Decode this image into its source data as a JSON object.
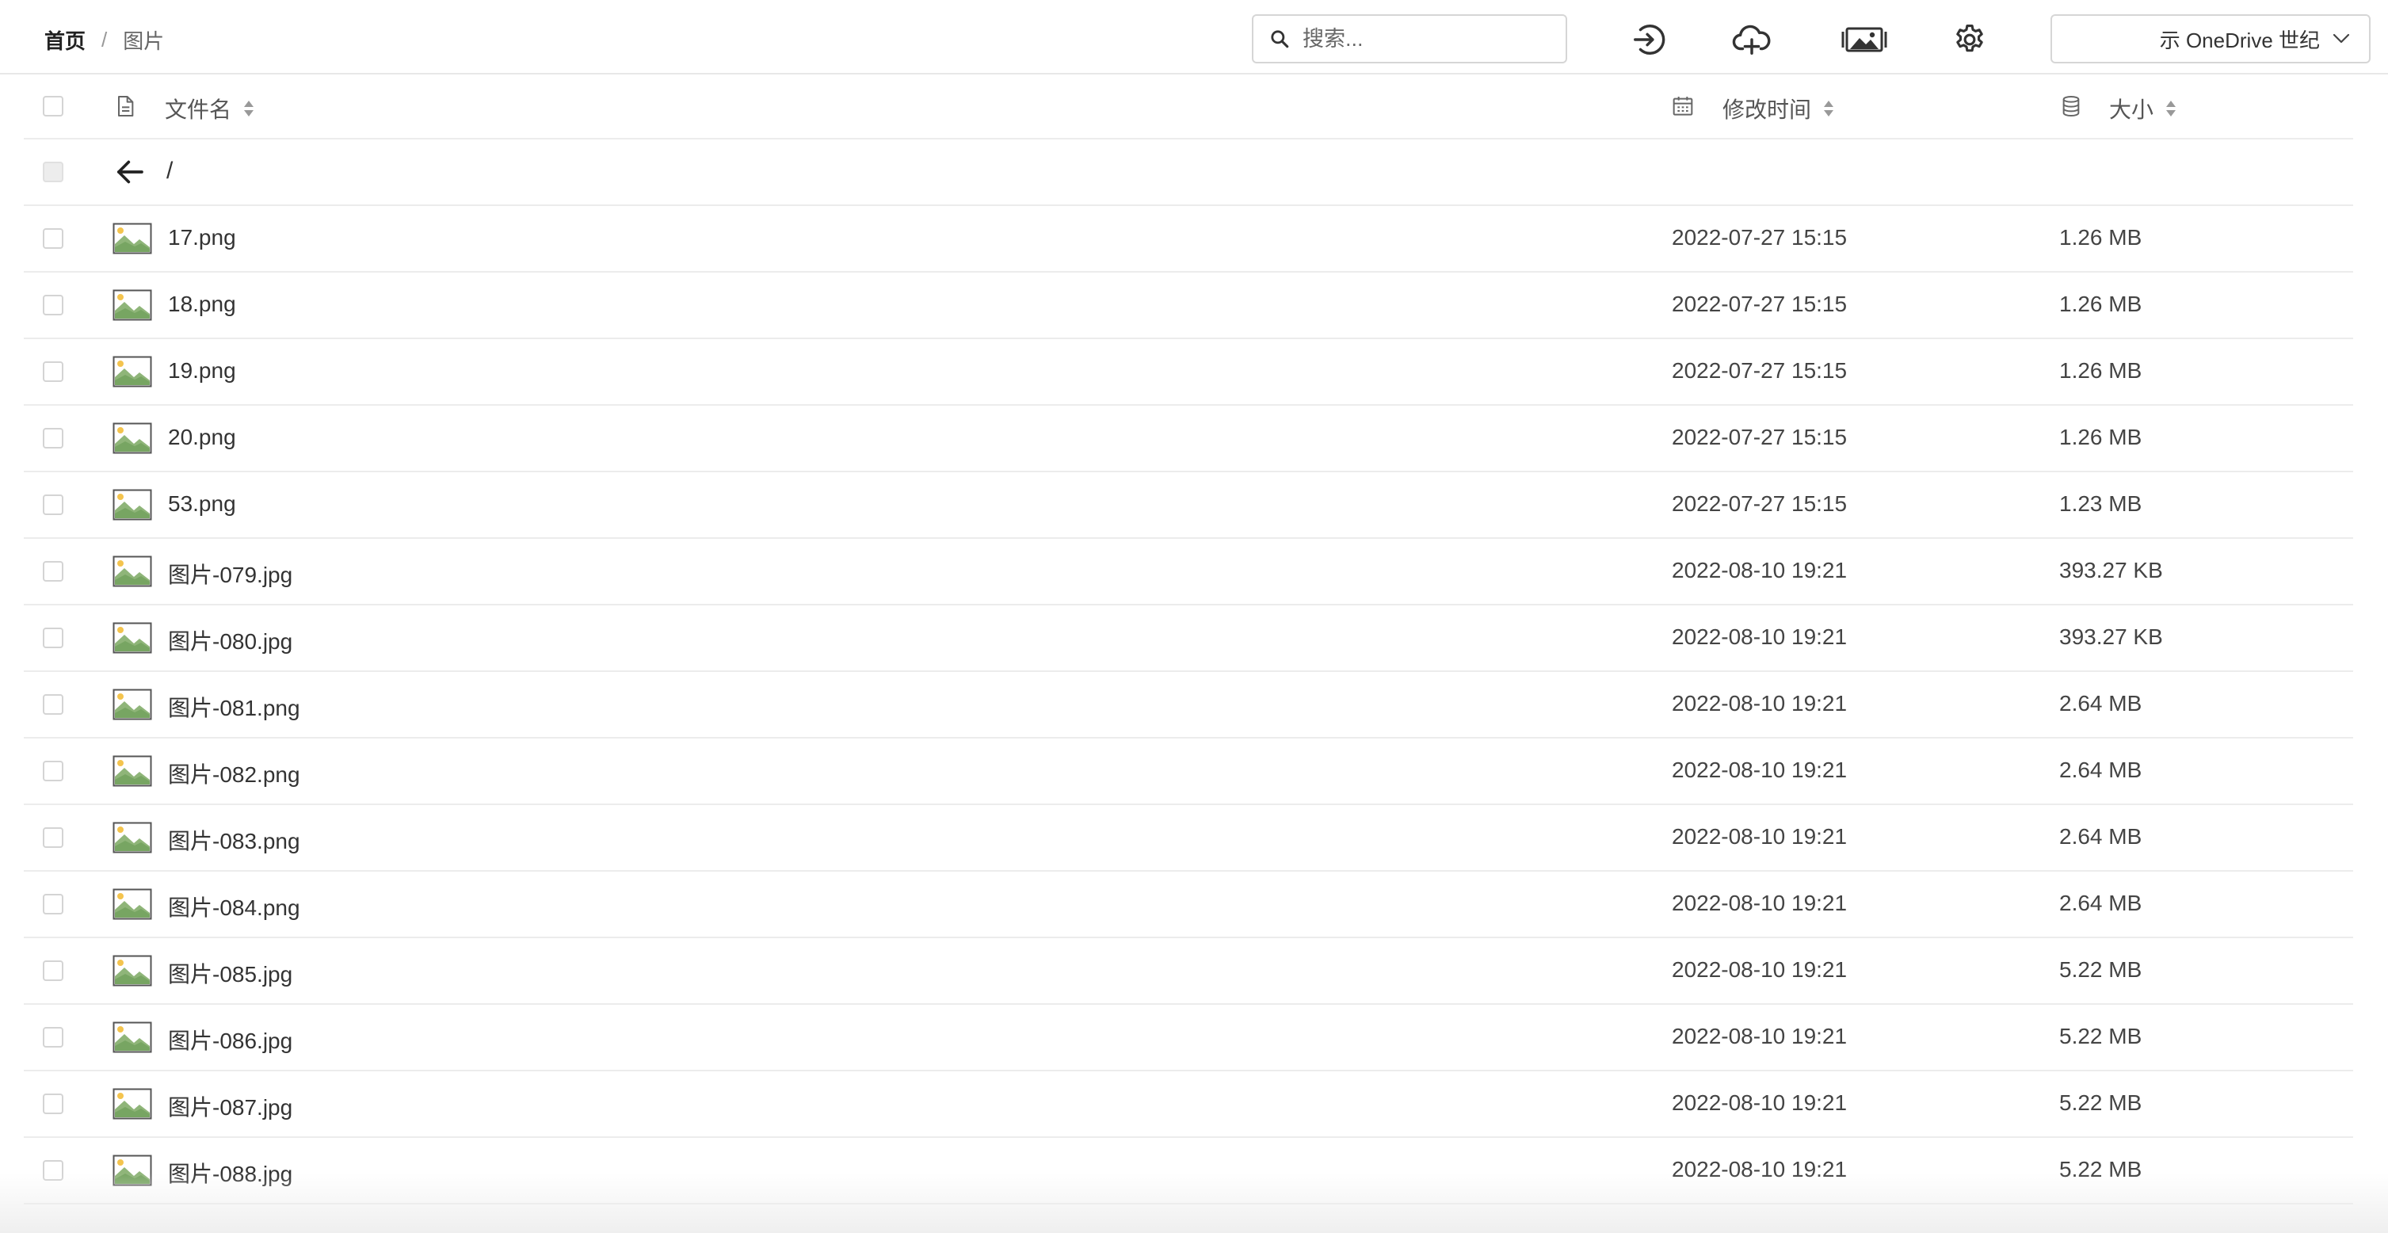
{
  "breadcrumb": {
    "home": "首页",
    "separator": "/",
    "current": "图片"
  },
  "search": {
    "placeholder": "搜索...",
    "value": ""
  },
  "drive": {
    "label": "示 OneDrive 世纪"
  },
  "columns": {
    "name": "文件名",
    "modified": "修改时间",
    "size": "大小"
  },
  "parent": {
    "path": "/"
  },
  "files": [
    {
      "name": "17.png",
      "modified": "2022-07-27 15:15",
      "size": "1.26 MB"
    },
    {
      "name": "18.png",
      "modified": "2022-07-27 15:15",
      "size": "1.26 MB"
    },
    {
      "name": "19.png",
      "modified": "2022-07-27 15:15",
      "size": "1.26 MB"
    },
    {
      "name": "20.png",
      "modified": "2022-07-27 15:15",
      "size": "1.26 MB"
    },
    {
      "name": "53.png",
      "modified": "2022-07-27 15:15",
      "size": "1.23 MB"
    },
    {
      "name": "图片-079.jpg",
      "modified": "2022-08-10 19:21",
      "size": "393.27 KB"
    },
    {
      "name": "图片-080.jpg",
      "modified": "2022-08-10 19:21",
      "size": "393.27 KB"
    },
    {
      "name": "图片-081.png",
      "modified": "2022-08-10 19:21",
      "size": "2.64 MB"
    },
    {
      "name": "图片-082.png",
      "modified": "2022-08-10 19:21",
      "size": "2.64 MB"
    },
    {
      "name": "图片-083.png",
      "modified": "2022-08-10 19:21",
      "size": "2.64 MB"
    },
    {
      "name": "图片-084.png",
      "modified": "2022-08-10 19:21",
      "size": "2.64 MB"
    },
    {
      "name": "图片-085.jpg",
      "modified": "2022-08-10 19:21",
      "size": "5.22 MB"
    },
    {
      "name": "图片-086.jpg",
      "modified": "2022-08-10 19:21",
      "size": "5.22 MB"
    },
    {
      "name": "图片-087.jpg",
      "modified": "2022-08-10 19:21",
      "size": "5.22 MB"
    },
    {
      "name": "图片-088.jpg",
      "modified": "2022-08-10 19:21",
      "size": "5.22 MB"
    }
  ],
  "icons": {
    "search": "search-icon",
    "login": "login-icon",
    "upload": "cloud-upload-icon",
    "gallery": "gallery-icon",
    "settings": "gear-icon",
    "chevron": "chevron-down-icon",
    "file": "file-icon",
    "calendar": "calendar-icon",
    "database": "database-icon",
    "back": "arrow-left-icon",
    "image": "image-file-icon"
  }
}
